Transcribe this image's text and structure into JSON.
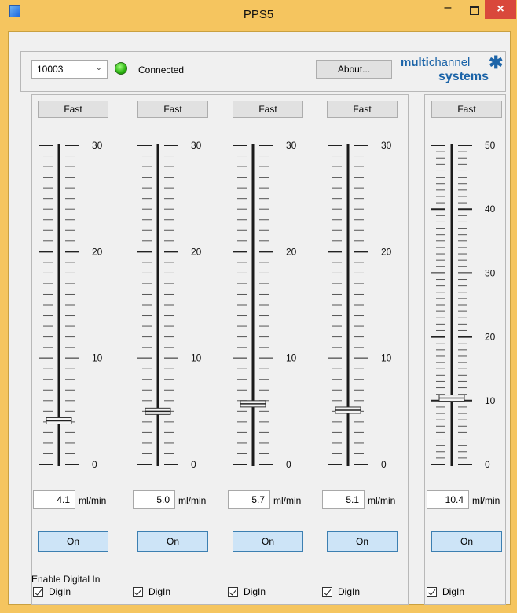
{
  "window": {
    "title": "PPS5"
  },
  "toolbar": {
    "device_id": "10003",
    "status": "Connected",
    "about_label": "About...",
    "brand_bold": "multi",
    "brand_light": "channel",
    "brand_line2": "systems"
  },
  "channels": [
    {
      "fast_label": "Fast",
      "value": "4.1",
      "unit": "ml/min",
      "on_label": "On",
      "digin_label": "DigIn",
      "slider_value": 4.1,
      "max": 30,
      "major_labels": [
        "30",
        "20",
        "10",
        "0"
      ]
    },
    {
      "fast_label": "Fast",
      "value": "5.0",
      "unit": "ml/min",
      "on_label": "On",
      "digin_label": "DigIn",
      "slider_value": 5.0,
      "max": 30,
      "major_labels": [
        "30",
        "20",
        "10",
        "0"
      ]
    },
    {
      "fast_label": "Fast",
      "value": "5.7",
      "unit": "ml/min",
      "on_label": "On",
      "digin_label": "DigIn",
      "slider_value": 5.7,
      "max": 30,
      "major_labels": [
        "30",
        "20",
        "10",
        "0"
      ]
    },
    {
      "fast_label": "Fast",
      "value": "5.1",
      "unit": "ml/min",
      "on_label": "On",
      "digin_label": "DigIn",
      "slider_value": 5.1,
      "max": 30,
      "major_labels": [
        "30",
        "20",
        "10",
        "0"
      ]
    },
    {
      "fast_label": "Fast",
      "value": "10.4",
      "unit": "ml/min",
      "on_label": "On",
      "digin_label": "DigIn",
      "slider_value": 10.4,
      "max": 50,
      "major_labels": [
        "50",
        "40",
        "30",
        "20",
        "10",
        "0"
      ]
    }
  ],
  "digital_in": {
    "title": "Enable Digital In"
  },
  "colors": {
    "title_bar": "#f5c55f",
    "led": "#29b10f",
    "close": "#d9483b",
    "brand": "#1c64a8",
    "on_button": "#cde4f7"
  }
}
